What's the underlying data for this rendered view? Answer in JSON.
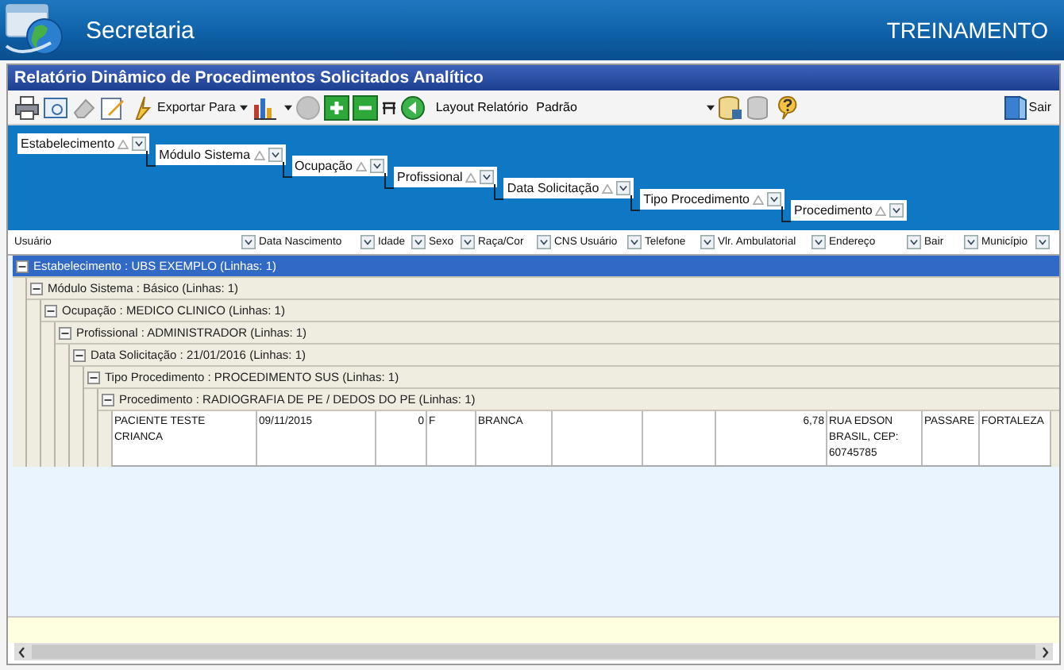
{
  "app": {
    "name": "Secretaria",
    "environment": "TREINAMENTO"
  },
  "report": {
    "title": "Relatório Dinâmico de Procedimentos Solicitados Analítico"
  },
  "toolbar": {
    "export_label": "Exportar Para",
    "layout_label": "Layout Relatório",
    "layout_value": "Padrão",
    "exit_label": "Sair"
  },
  "group_by": [
    {
      "label": "Estabelecimento"
    },
    {
      "label": "Módulo Sistema"
    },
    {
      "label": "Ocupação"
    },
    {
      "label": "Profissional"
    },
    {
      "label": "Data Solicitação"
    },
    {
      "label": "Tipo Procedimento"
    },
    {
      "label": "Procedimento"
    }
  ],
  "columns": [
    {
      "label": "Usuário",
      "kind": "text"
    },
    {
      "label": "Data Nascimento",
      "kind": "text"
    },
    {
      "label": "Idade",
      "kind": "number"
    },
    {
      "label": "Sexo",
      "kind": "text"
    },
    {
      "label": "Raça/Cor",
      "kind": "text"
    },
    {
      "label": "CNS Usuário",
      "kind": "text"
    },
    {
      "label": "Telefone",
      "kind": "text"
    },
    {
      "label": "Vlr. Ambulatorial",
      "kind": "number"
    },
    {
      "label": "Endereço",
      "kind": "text"
    },
    {
      "label": "Bair",
      "kind": "text"
    },
    {
      "label": "Município",
      "kind": "text"
    }
  ],
  "groups": [
    {
      "label": "Estabelecimento : UBS EXEMPLO (Linhas: 1)",
      "expanded": true,
      "selected": true,
      "children": [
        {
          "label": "Módulo Sistema : Básico (Linhas: 1)",
          "expanded": true,
          "selected": false,
          "children": [
            {
              "label": "Ocupação : MEDICO CLINICO (Linhas: 1)",
              "expanded": true,
              "selected": false,
              "children": [
                {
                  "label": "Profissional : ADMINISTRADOR (Linhas: 1)",
                  "expanded": true,
                  "selected": false,
                  "children": [
                    {
                      "label": "Data Solicitação : 21/01/2016 (Linhas: 1)",
                      "expanded": true,
                      "selected": false,
                      "children": [
                        {
                          "label": "Tipo Procedimento : PROCEDIMENTO SUS (Linhas: 1)",
                          "expanded": true,
                          "selected": false,
                          "children": [
                            {
                              "label": "Procedimento : RADIOGRAFIA DE PE / DEDOS DO PE (Linhas: 1)",
                              "expanded": true,
                              "selected": false,
                              "rows": [
                                {
                                  "cells": [
                                    "PACIENTE TESTE CRIANCA",
                                    "09/11/2015",
                                    "0",
                                    "F",
                                    "BRANCA",
                                    null,
                                    null,
                                    "6,78",
                                    "RUA EDSON BRASIL, CEP: 60745785",
                                    "PASSARE",
                                    "FORTALEZA"
                                  ]
                                }
                              ]
                            }
                          ]
                        }
                      ]
                    }
                  ]
                }
              ]
            }
          ]
        }
      ]
    }
  ]
}
